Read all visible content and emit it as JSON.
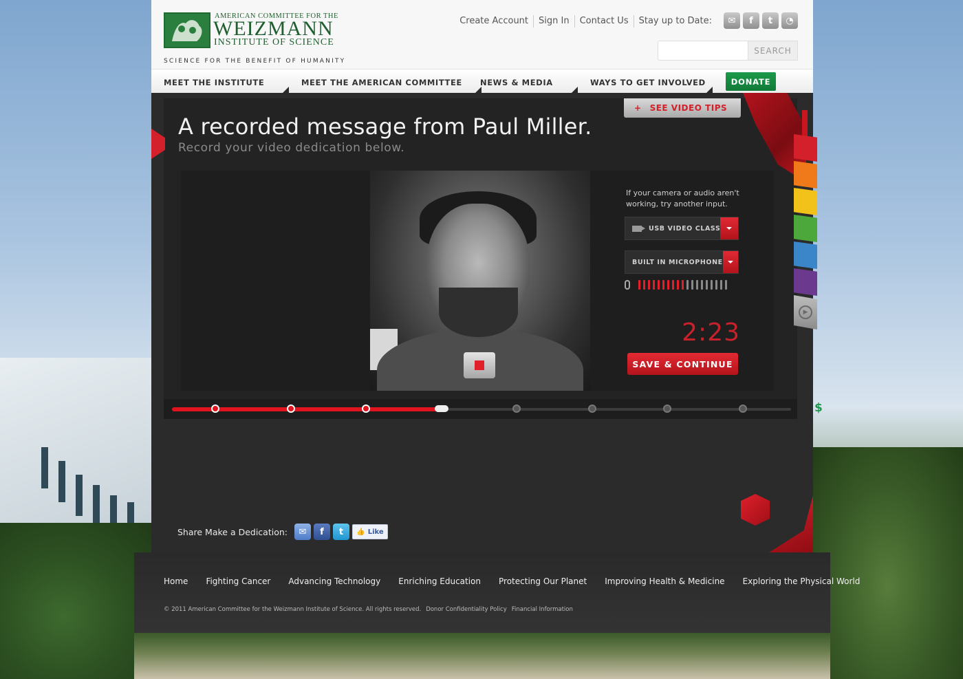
{
  "header": {
    "logo": {
      "line1": "AMERICAN COMMITTEE FOR THE",
      "line2": "WEIZMANN",
      "line3": "INSTITUTE OF SCIENCE",
      "tagline": "SCIENCE FOR THE BENEFIT OF HUMANITY"
    },
    "top_links": [
      "Create Account",
      "Sign In",
      "Contact Us",
      "Stay up to Date:"
    ],
    "social_icons": [
      "email-icon",
      "facebook-icon",
      "twitter-icon",
      "rss-icon"
    ],
    "search": {
      "button_label": "SEARCH",
      "value": ""
    }
  },
  "nav": {
    "items": [
      "MEET THE INSTITUTE",
      "MEET THE AMERICAN COMMITTEE",
      "NEWS & MEDIA",
      "WAYS TO GET INVOLVED"
    ],
    "donate_label": "DONATE"
  },
  "recorder": {
    "title": "A recorded message from Paul Miller.",
    "subtitle": "Record your video dedication below.",
    "tips_plus": "+",
    "tips_label": "SEE VIDEO TIPS",
    "hint": "If your camera or audio aren't working, try another input.",
    "camera_select": "USB VIDEO CLASS",
    "mic_select": "BUILT IN MICROPHONE",
    "audio_level": {
      "active": 10,
      "total": 19
    },
    "timer": "2:23",
    "save_label": "SAVE & CONTINUE",
    "progress": {
      "steps_total": 9,
      "steps_complete": 3,
      "current": 4,
      "final_icon": "$"
    }
  },
  "share": {
    "label": "Share Make a Dedication:",
    "icons": [
      "email-icon",
      "facebook-icon",
      "twitter-icon"
    ],
    "like_label": "Like"
  },
  "side_tabs": {
    "colors": [
      "#d4202b",
      "#f07a1a",
      "#f2c21b",
      "#4ca83a",
      "#3b86c8",
      "#6b3a8f"
    ]
  },
  "footer": {
    "links": [
      "Home",
      "Fighting Cancer",
      "Advancing Technology",
      "Enriching Education",
      "Protecting Our Planet",
      "Improving Health & Medicine",
      "Exploring the Physical World"
    ],
    "copyright": "© 2011 American Committee for the Weizmann Institute of Science. All rights reserved.",
    "legal_links": [
      "Donor Confidentiality Policy",
      "Financial Information"
    ]
  },
  "colors": {
    "brand_green": "#1f5e2e",
    "accent_red": "#d4202b",
    "donate_green": "#127a38"
  }
}
